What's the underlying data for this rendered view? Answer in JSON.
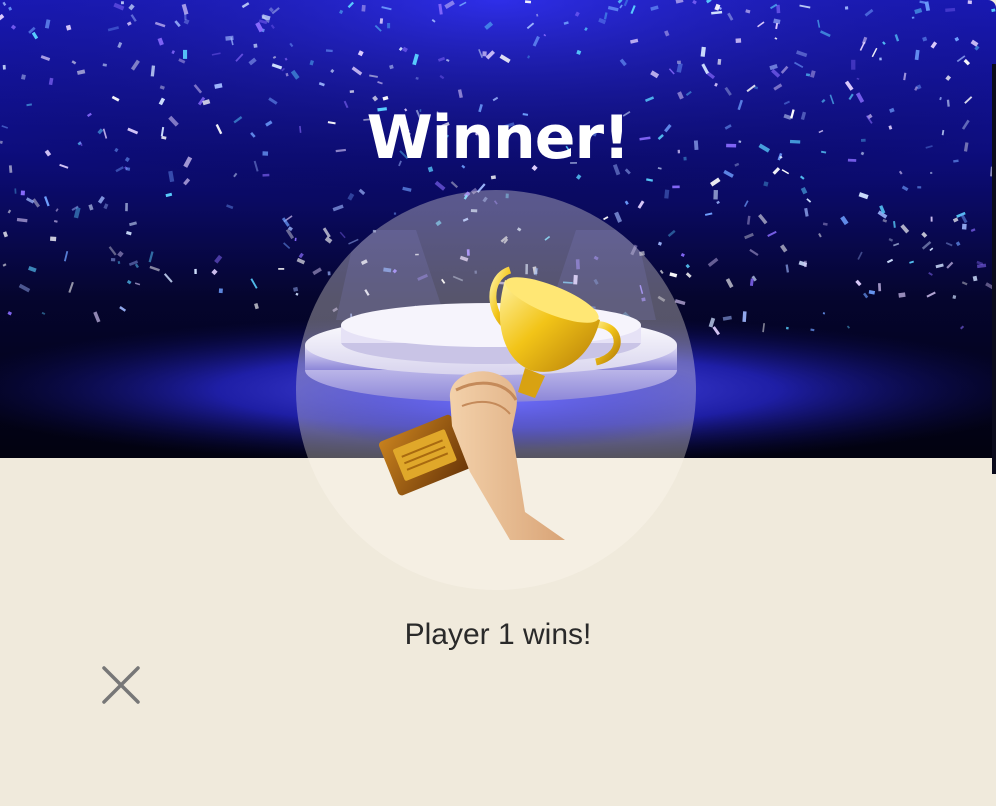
{
  "dialog": {
    "title": "Winner!",
    "message": "Player 1 wins!",
    "close_icon": "close-icon",
    "trophy_icon": "trophy-in-hand-icon"
  },
  "colors": {
    "background": "#f0eadc",
    "banner_dark": "#06062a",
    "banner_blue": "#1a1ad8",
    "title_text": "#ffffff",
    "message_text": "#2a2a2a",
    "close_icon": "#777777",
    "trophy_gold": "#e8b40e"
  }
}
